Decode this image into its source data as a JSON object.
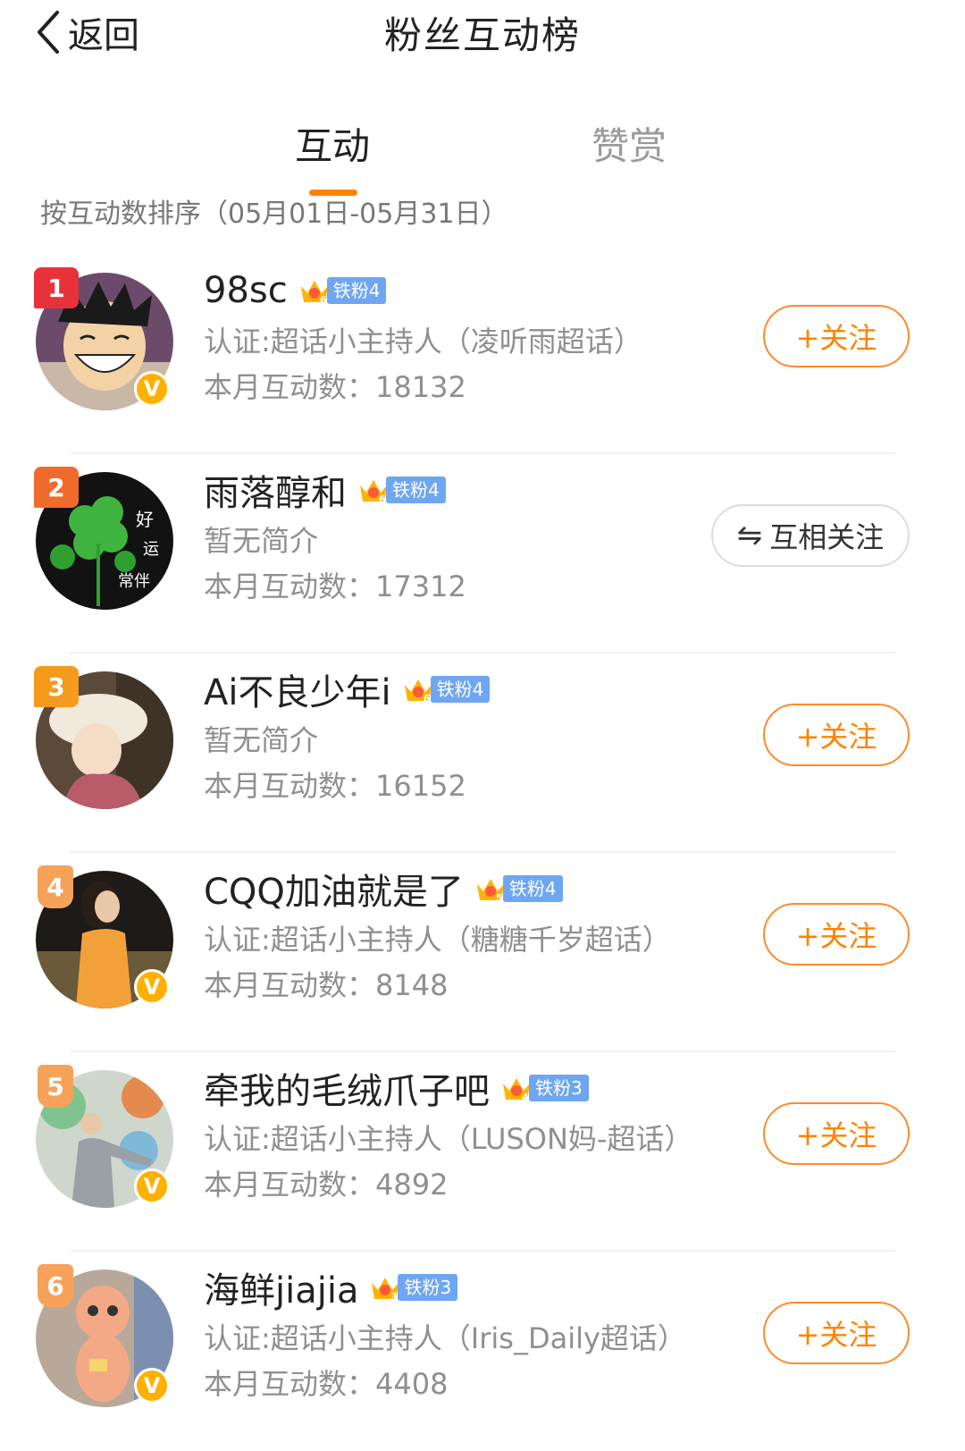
{
  "header": {
    "back_label": "返回",
    "title": "粉丝互动榜"
  },
  "tabs": [
    {
      "label": "互动",
      "active": true
    },
    {
      "label": "赞赏",
      "active": false
    }
  ],
  "sort_label": "按互动数排序（05月01日-05月31日）",
  "accent_color": "#ff8200",
  "users": [
    {
      "rank": "1",
      "name": "98sc",
      "fan_level": "铁粉4",
      "crown_level": "6",
      "desc": "认证:超话小主持人（凌听雨超话）",
      "count": "本月互动数：18132",
      "verified": true,
      "button": "+关注",
      "button_type": "follow"
    },
    {
      "rank": "2",
      "name": "雨落醇和",
      "fan_level": "铁粉4",
      "crown_level": "6",
      "desc": "暂无简介",
      "count": "本月互动数：17312",
      "verified": false,
      "button": "互相关注",
      "button_type": "mutual"
    },
    {
      "rank": "3",
      "name": "Ai不良少年i",
      "fan_level": "铁粉4",
      "crown_level": "6",
      "desc": "暂无简介",
      "count": "本月互动数：16152",
      "verified": false,
      "button": "+关注",
      "button_type": "follow"
    },
    {
      "rank": "4",
      "name": "CQQ加油就是了",
      "fan_level": "铁粉4",
      "crown_level": "5",
      "desc": "认证:超话小主持人（糖糖千岁超话）",
      "count": "本月互动数：8148",
      "verified": true,
      "button": "+关注",
      "button_type": "follow"
    },
    {
      "rank": "5",
      "name": "牵我的毛绒爪子吧",
      "fan_level": "铁粉3",
      "crown_level": "4",
      "desc": "认证:超话小主持人（LUSON妈-超话）",
      "count": "本月互动数：4892",
      "verified": true,
      "button": "+关注",
      "button_type": "follow"
    },
    {
      "rank": "6",
      "name": "海鲜jiajia",
      "fan_level": "铁粉3",
      "crown_level": "3",
      "desc": "认证:超话小主持人（Iris_Daily超话）",
      "count": "本月互动数：4408",
      "verified": true,
      "button": "+关注",
      "button_type": "follow"
    }
  ]
}
